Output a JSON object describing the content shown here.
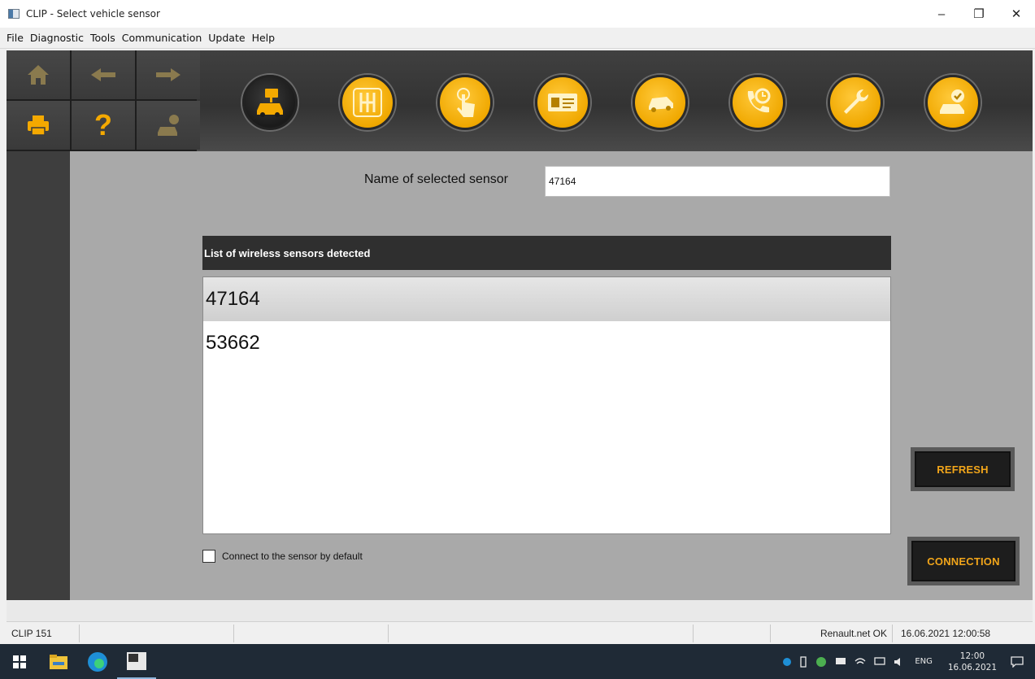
{
  "window": {
    "title": "CLIP - Select vehicle sensor",
    "minimize": "–",
    "restore": "❐",
    "close": "✕"
  },
  "menu": [
    "File",
    "Diagnostic",
    "Tools",
    "Communication",
    "Update",
    "Help"
  ],
  "toolbar": {
    "nav_icons": [
      "home-icon",
      "back-arrow-icon",
      "forward-arrow-icon",
      "printer-icon",
      "help-icon",
      "vehicle-info-icon"
    ],
    "help_glyph": "?",
    "circle_icons": [
      "vehicle-sensor-icon",
      "gearbox-icon",
      "touch-icon",
      "id-card-icon",
      "vehicle-scan-icon",
      "phone-support-icon",
      "wrench-icon",
      "vehicle-check-icon"
    ],
    "accent_color": "#F4A900"
  },
  "sensor_name": {
    "label": "Name of selected sensor",
    "value": "47164"
  },
  "sensor_list": {
    "header": "List of wireless sensors detected",
    "items": [
      "47164",
      "53662"
    ],
    "selected_index": 0
  },
  "default_connect": {
    "label": "Connect to the sensor by default",
    "checked": false
  },
  "buttons": {
    "refresh": "REFRESH",
    "connection": "CONNECTION"
  },
  "status": {
    "device": "CLIP 151",
    "network": "Renault.net OK",
    "datetime": "16.06.2021 12:00:58"
  },
  "taskbar": {
    "lang": "ENG",
    "time": "12:00",
    "date": "16.06.2021"
  }
}
